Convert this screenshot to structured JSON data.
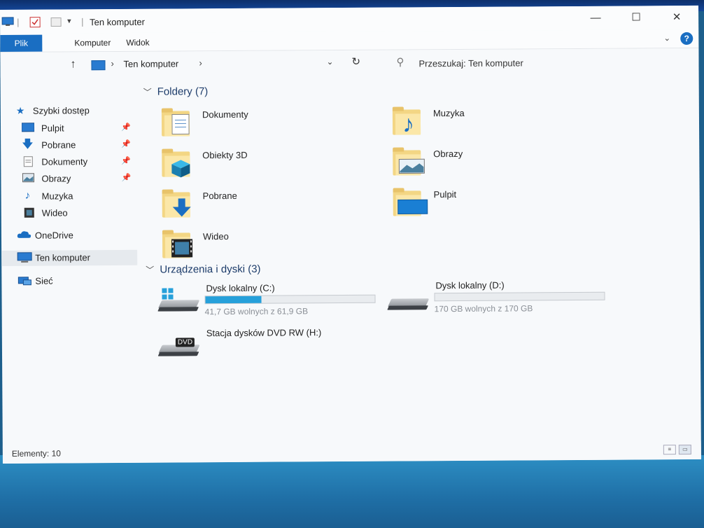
{
  "window": {
    "title": "Ten komputer",
    "minimize": "—",
    "maximize": "☐",
    "close": "✕"
  },
  "ribbon": {
    "tabs": [
      "Plik",
      "Komputer",
      "Widok"
    ],
    "help": "?"
  },
  "address": {
    "path": "Ten komputer",
    "search_placeholder": "Przeszukaj: Ten komputer"
  },
  "sidebar": {
    "quick_access": "Szybki dostęp",
    "items": [
      {
        "label": "Pulpit",
        "icon": "desktop-icon",
        "pinned": true
      },
      {
        "label": "Pobrane",
        "icon": "download-icon",
        "pinned": true
      },
      {
        "label": "Dokumenty",
        "icon": "document-icon",
        "pinned": true
      },
      {
        "label": "Obrazy",
        "icon": "picture-icon",
        "pinned": true
      },
      {
        "label": "Muzyka",
        "icon": "music-icon",
        "pinned": false
      },
      {
        "label": "Wideo",
        "icon": "video-icon",
        "pinned": false
      }
    ],
    "onedrive": "OneDrive",
    "this_pc": "Ten komputer",
    "network": "Sieć"
  },
  "folders": {
    "header": "Foldery (7)",
    "items": [
      {
        "label": "Dokumenty",
        "icon": "documents-folder-icon"
      },
      {
        "label": "Muzyka",
        "icon": "music-folder-icon"
      },
      {
        "label": "Obiekty 3D",
        "icon": "3d-objects-folder-icon"
      },
      {
        "label": "Obrazy",
        "icon": "pictures-folder-icon"
      },
      {
        "label": "Pobrane",
        "icon": "downloads-folder-icon"
      },
      {
        "label": "Pulpit",
        "icon": "desktop-folder-icon"
      },
      {
        "label": "Wideo",
        "icon": "videos-folder-icon"
      }
    ]
  },
  "devices": {
    "header": "Urządzenia i dyski (3)",
    "drives": [
      {
        "name": "Dysk lokalny (C:)",
        "free": "41,7 GB wolnych z 61,9 GB",
        "used_fraction": 0.33
      },
      {
        "name": "Dysk lokalny (D:)",
        "free": "170 GB wolnych z 170 GB",
        "used_fraction": 0.0
      },
      {
        "name": "Stacja dysków DVD RW (H:)",
        "dvd_label": "DVD"
      }
    ]
  },
  "status": {
    "items": "Elementy: 10"
  },
  "colors": {
    "accent": "#1a6ec2",
    "drive_fill": "#26a0da",
    "folder": "#f3d684"
  }
}
